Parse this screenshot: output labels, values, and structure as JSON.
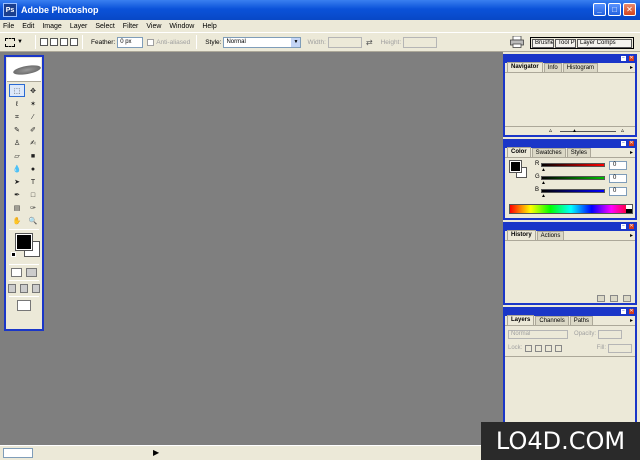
{
  "window": {
    "title": "Adobe Photoshop",
    "icon_label": "Ps"
  },
  "menu": [
    "File",
    "Edit",
    "Image",
    "Layer",
    "Select",
    "Filter",
    "View",
    "Window",
    "Help"
  ],
  "options_bar": {
    "feather_label": "Feather:",
    "feather_value": "0 px",
    "antialias_label": "Anti-aliased",
    "style_label": "Style:",
    "style_value": "Normal",
    "width_label": "Width:",
    "height_label": "Height:",
    "well_tabs": [
      "Brushe",
      "Tool P",
      "Layer Comps"
    ]
  },
  "panels": {
    "navigator": {
      "tabs": [
        "Navigator",
        "Info",
        "Histogram"
      ]
    },
    "color": {
      "tabs": [
        "Color",
        "Swatches",
        "Styles"
      ],
      "channels": [
        {
          "letter": "R",
          "value": "0",
          "gradient": "#ff0000"
        },
        {
          "letter": "G",
          "value": "0",
          "gradient": "#00c000"
        },
        {
          "letter": "B",
          "value": "0",
          "gradient": "#0000ff"
        }
      ]
    },
    "history": {
      "tabs": [
        "History",
        "Actions"
      ]
    },
    "layers": {
      "tabs": [
        "Layers",
        "Channels",
        "Paths"
      ],
      "blend_mode": "Normal",
      "opacity_label": "Opacity:",
      "lock_label": "Lock:",
      "fill_label": "Fill:"
    }
  },
  "toolbox": {
    "tools": [
      "rect-marquee-tool",
      "move-tool",
      "lasso-tool",
      "magic-wand-tool",
      "crop-tool",
      "slice-tool",
      "healing-brush-tool",
      "brush-tool",
      "clone-stamp-tool",
      "history-brush-tool",
      "eraser-tool",
      "gradient-tool",
      "blur-tool",
      "dodge-tool",
      "path-selection-tool",
      "type-tool",
      "pen-tool",
      "rectangle-shape-tool",
      "notes-tool",
      "eyedropper-tool",
      "hand-tool",
      "zoom-tool"
    ],
    "glyphs": [
      "⬚",
      "✥",
      "ℓ",
      "✶",
      "⌗",
      "⁄",
      "✎",
      "✐",
      "♙",
      "✍",
      "▱",
      "■",
      "💧",
      "●",
      "➤",
      "T",
      "✒",
      "□",
      "▤",
      "✑",
      "✋",
      "🔍"
    ],
    "foreground_color": "#000000",
    "background_color": "#ffffff"
  },
  "watermark": "LO4D.COM",
  "colors": {
    "accent": "#1a36c8",
    "workspace": "#7f7f7f",
    "titlebar": "#0b52d9"
  }
}
